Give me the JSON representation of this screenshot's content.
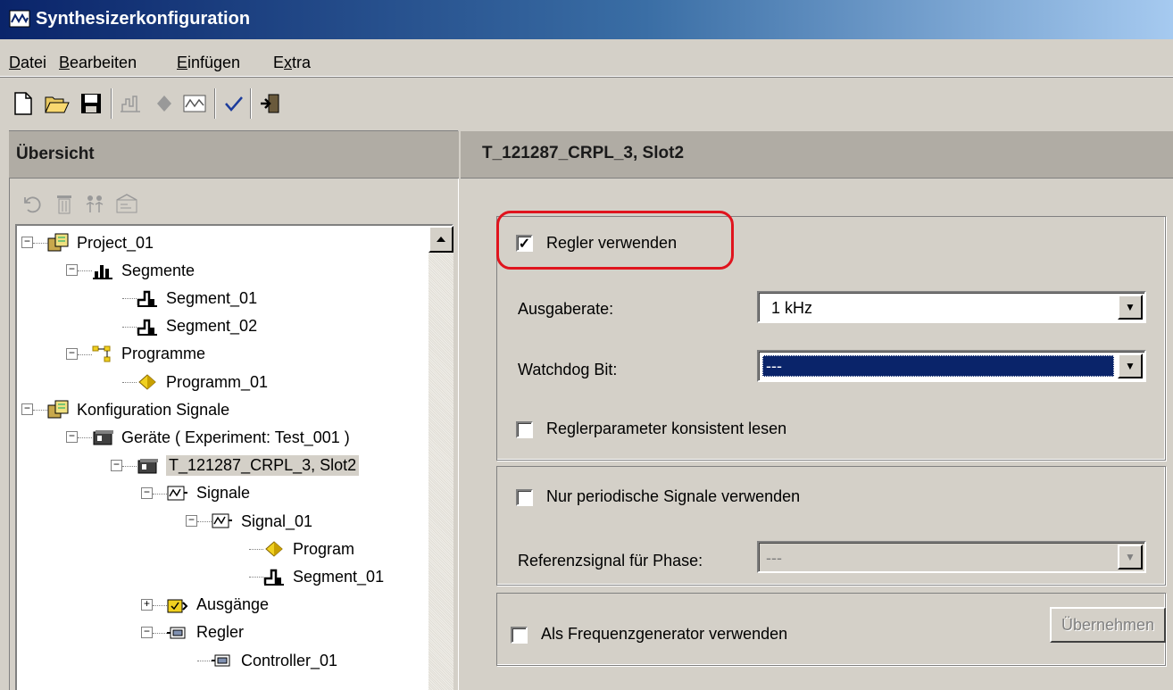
{
  "window": {
    "title": "Synthesizerkonfiguration",
    "icon": "signal-window-icon"
  },
  "menu": [
    {
      "label": "Datei",
      "accel": "D"
    },
    {
      "label": "Bearbeiten",
      "accel": "B"
    },
    {
      "label": "Einfügen",
      "accel": "E"
    },
    {
      "label": "Extra",
      "accel": "x"
    }
  ],
  "toolbar": [
    "new-file-icon",
    "open-folder-icon",
    "save-icon",
    "segment-icon",
    "program-icon",
    "signal-icon",
    "check-icon",
    "exit-icon"
  ],
  "left": {
    "header": "Übersicht",
    "tools": [
      "undo-icon",
      "delete-icon",
      "users-icon",
      "properties-icon"
    ]
  },
  "tree": [
    {
      "label": "Project_01",
      "icon": "project-icon",
      "level": 0
    },
    {
      "label": "Segmente",
      "icon": "segments-icon",
      "level": 1
    },
    {
      "label": "Segment_01",
      "icon": "segment-icon",
      "level": 2
    },
    {
      "label": "Segment_02",
      "icon": "segment-icon",
      "level": 2
    },
    {
      "label": "Programme",
      "icon": "programs-icon",
      "level": 1
    },
    {
      "label": "Programm_01",
      "icon": "program-icon",
      "level": 2
    },
    {
      "label": "Konfiguration Signale",
      "icon": "project-icon",
      "level": 0
    },
    {
      "label": "Geräte ( Experiment: Test_001 )",
      "icon": "devices-icon",
      "level": 1
    },
    {
      "label": "T_121287_CRPL_3, Slot2",
      "icon": "device-icon",
      "level": 2,
      "selected": true
    },
    {
      "label": "Signale",
      "icon": "signals-icon",
      "level": 3
    },
    {
      "label": "Signal_01",
      "icon": "signal-icon",
      "level": 4
    },
    {
      "label": "Program",
      "icon": "program-icon",
      "level": 5
    },
    {
      "label": "Segment_01",
      "icon": "segment-icon",
      "level": 5
    },
    {
      "label": "Ausgänge",
      "icon": "outputs-icon",
      "level": 3
    },
    {
      "label": "Regler",
      "icon": "controller-icon",
      "level": 3
    },
    {
      "label": "Controller_01",
      "icon": "controller-icon",
      "level": 4
    }
  ],
  "right": {
    "header": "T_121287_CRPL_3, Slot2",
    "regler_verwenden": {
      "label": "Regler verwenden",
      "checked": true
    },
    "ausgaberate": {
      "label": "Ausgaberate:",
      "value": "1 kHz"
    },
    "watchdog": {
      "label": "Watchdog Bit:",
      "value": "---"
    },
    "konsistent": {
      "label": "Reglerparameter konsistent lesen",
      "checked": false
    },
    "periodisch": {
      "label": "Nur periodische Signale verwenden",
      "checked": false
    },
    "referenz": {
      "label": "Referenzsignal für Phase:",
      "value": "---"
    },
    "frequenzgenerator": {
      "label": "Als Frequenzgenerator verwenden",
      "checked": false
    },
    "apply_button": "Übernehmen"
  },
  "colors": {
    "titlebar": "#0a246a",
    "selection": "#0a246a",
    "highlight": "#e0141e"
  }
}
